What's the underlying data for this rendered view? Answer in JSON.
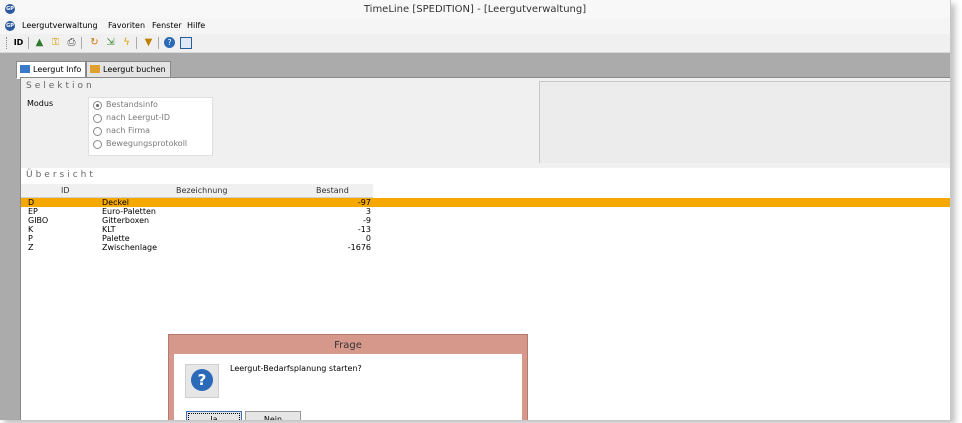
{
  "window": {
    "title": "TimeLine [SPEDITION] - [Leergutverwaltung]"
  },
  "menu": [
    "Leergutverwaltung",
    "Favoriten",
    "Fenster",
    "Hilfe"
  ],
  "toolbar_icons": [
    "id-icon",
    "printer-preview-icon",
    "key-icon",
    "print-icon",
    "refresh-icon",
    "export-icon",
    "flash-icon",
    "filter-icon",
    "help-icon",
    "window-icon"
  ],
  "tabs": [
    {
      "label": "Leergut Info",
      "active": true
    },
    {
      "label": "Leergut buchen",
      "active": false
    }
  ],
  "selektion": {
    "title": "Selektion",
    "modus_label": "Modus",
    "options": [
      {
        "label": "Bestandsinfo",
        "checked": true
      },
      {
        "label": "nach Leergut-ID",
        "checked": false
      },
      {
        "label": "nach Firma",
        "checked": false
      },
      {
        "label": "Bewegungsprotokoll",
        "checked": false
      }
    ]
  },
  "uebersicht": {
    "title": "Übersicht",
    "columns": [
      "ID",
      "Bezeichnung",
      "Bestand"
    ],
    "rows": [
      {
        "id": "D",
        "bezeichnung": "Deckel",
        "bestand": "-97",
        "selected": true
      },
      {
        "id": "EP",
        "bezeichnung": "Euro-Paletten",
        "bestand": "3",
        "selected": false
      },
      {
        "id": "GIBO",
        "bezeichnung": "Gitterboxen",
        "bestand": "-9",
        "selected": false
      },
      {
        "id": "K",
        "bezeichnung": "KLT",
        "bestand": "-13",
        "selected": false
      },
      {
        "id": "P",
        "bezeichnung": "Palette",
        "bestand": "0",
        "selected": false
      },
      {
        "id": "Z",
        "bezeichnung": "Zwischenlage",
        "bestand": "-1676",
        "selected": false
      }
    ]
  },
  "dialog": {
    "title": "Frage",
    "message": "Leergut-Bedarfsplanung starten?",
    "yes_label": "Ja",
    "no_label": "Nein"
  },
  "colors": {
    "selected_row": "#f5a800",
    "dialog_frame": "#d7988c",
    "workspace": "#ababab"
  }
}
